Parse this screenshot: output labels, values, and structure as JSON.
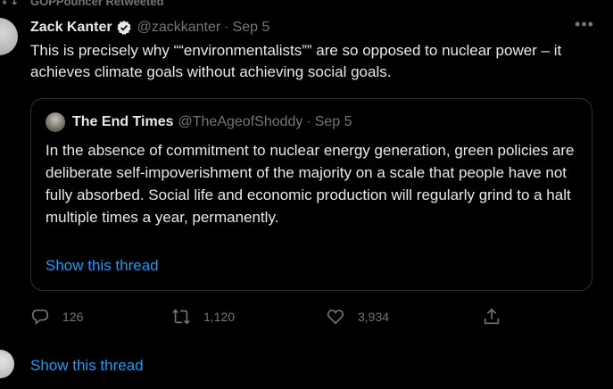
{
  "social_context": {
    "text": "GOPPouncer Retweeted"
  },
  "tweet": {
    "author_name": "Zack Kanter",
    "handle": "@zackkanter",
    "separator": "·",
    "date": "Sep 5",
    "more_label": "•••",
    "text": "This is precisely why ““environmentalists”” are so opposed to nuclear power – it achieves climate goals without achieving social goals."
  },
  "quote": {
    "author_name": "The End Times",
    "handle": "@TheAgeofShoddy",
    "separator": "·",
    "date": "Sep 5",
    "text": "In the absence of commitment to nuclear energy generation, green policies are deliberate self-impoverishment of the majority on a scale that people have not fully absorbed.  Social life and economic production will regularly grind to a halt multiple times a year, permanently.",
    "show_thread": "Show this thread"
  },
  "actions": {
    "replies": "126",
    "retweets": "1,120",
    "likes": "3,934"
  },
  "footer": {
    "show_thread": "Show this thread"
  },
  "colors": {
    "background": "#000000",
    "text_primary": "#e7e9ea",
    "text_secondary": "#71767b",
    "accent": "#1d9bf0",
    "border": "#2f3336"
  },
  "icons": {
    "retweeted": "retweet-icon",
    "verified": "verified-badge-icon",
    "more": "more-icon",
    "reply": "reply-icon",
    "retweet": "retweet-icon",
    "like": "heart-icon",
    "share": "share-icon"
  }
}
